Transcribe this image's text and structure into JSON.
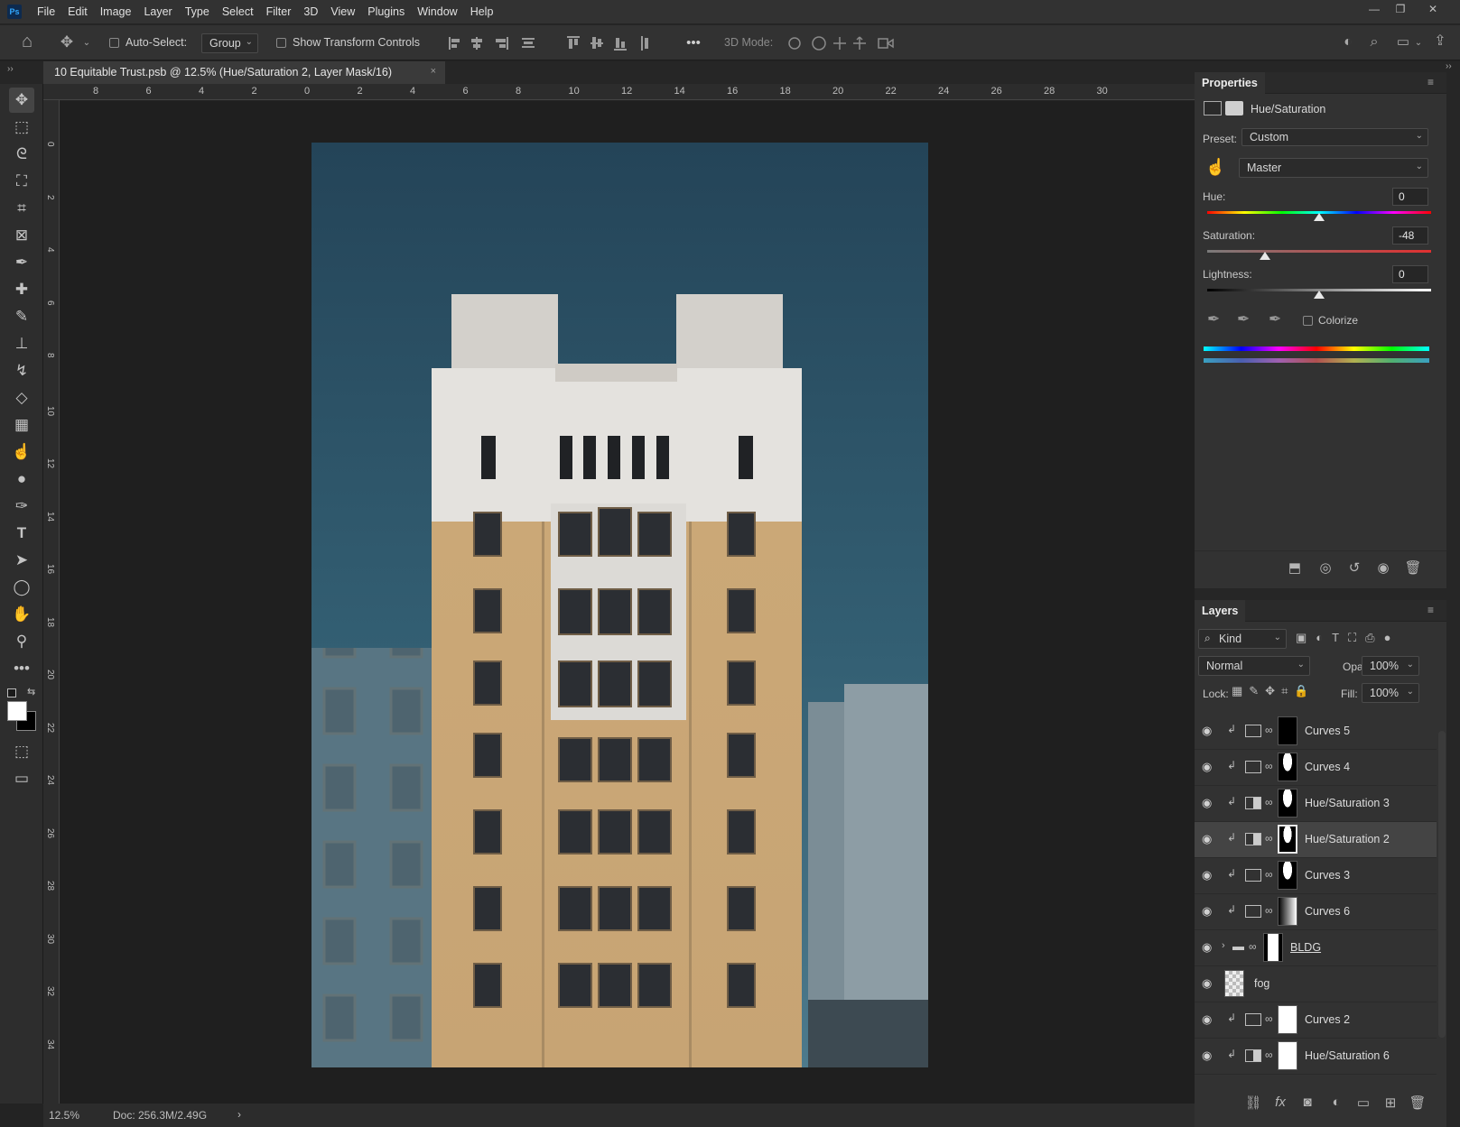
{
  "app": {
    "logo_text": "Ps"
  },
  "menu": [
    "File",
    "Edit",
    "Image",
    "Layer",
    "Type",
    "Select",
    "Filter",
    "3D",
    "View",
    "Plugins",
    "Window",
    "Help"
  ],
  "window_controls": {
    "minimize": "—",
    "restore": "❐",
    "close": "✕"
  },
  "options_bar": {
    "auto_select_label": "Auto-Select:",
    "group_value": "Group",
    "show_transform_label": "Show Transform Controls",
    "mode_3d_label": "3D Mode:",
    "more": "•••"
  },
  "document_tab": {
    "title": "10 Equitable Trust.psb @ 12.5% (Hue/Saturation 2, Layer Mask/16)",
    "close": "×"
  },
  "ruler_h": [
    "8",
    "6",
    "4",
    "2",
    "0",
    "2",
    "4",
    "6",
    "8",
    "10",
    "12",
    "14",
    "16",
    "18",
    "20",
    "22",
    "24",
    "26",
    "28",
    "30"
  ],
  "ruler_v": [
    "0",
    "2",
    "4",
    "6",
    "8",
    "10",
    "12",
    "14",
    "16",
    "18",
    "20",
    "22",
    "24",
    "26",
    "28",
    "30",
    "32",
    "34"
  ],
  "status": {
    "zoom": "12.5%",
    "doc": "Doc: 256.3M/2.49G",
    "arrow": "›"
  },
  "properties": {
    "tab": "Properties",
    "adjustment_name": "Hue/Saturation",
    "preset_label": "Preset:",
    "preset_value": "Custom",
    "channel_value": "Master",
    "hue_label": "Hue:",
    "hue_value": "0",
    "hue_pct": 0.5,
    "saturation_label": "Saturation:",
    "saturation_value": "-48",
    "saturation_pct": 0.26,
    "lightness_label": "Lightness:",
    "lightness_value": "0",
    "lightness_pct": 0.5,
    "colorize_label": "Colorize"
  },
  "layers": {
    "tab": "Layers",
    "kind_value": "Kind",
    "blend_mode": "Normal",
    "opacity_label": "Opacity:",
    "opacity_value": "100%",
    "lock_label": "Lock:",
    "fill_label": "Fill:",
    "fill_value": "100%",
    "items": [
      {
        "name": "Curves 5",
        "type": "curves",
        "mask": "dark",
        "clipped": true
      },
      {
        "name": "Curves 4",
        "type": "curves",
        "mask": "tower",
        "clipped": true
      },
      {
        "name": "Hue/Saturation 3",
        "type": "huesat",
        "mask": "tower",
        "clipped": true
      },
      {
        "name": "Hue/Saturation 2",
        "type": "huesat",
        "mask": "tower",
        "clipped": true,
        "selected": true
      },
      {
        "name": "Curves 3",
        "type": "curves",
        "mask": "tower",
        "clipped": true
      },
      {
        "name": "Curves 6",
        "type": "curves",
        "mask": "gradient",
        "clipped": true
      },
      {
        "name": "BLDG",
        "type": "group",
        "mask": "building",
        "clipped": false
      },
      {
        "name": "fog",
        "type": "pixel",
        "mask": "none",
        "clipped": false
      },
      {
        "name": "Curves 2",
        "type": "curves",
        "mask": "white",
        "clipped": true
      },
      {
        "name": "Hue/Saturation 6",
        "type": "huesat",
        "mask": "white",
        "clipped": true
      }
    ]
  }
}
